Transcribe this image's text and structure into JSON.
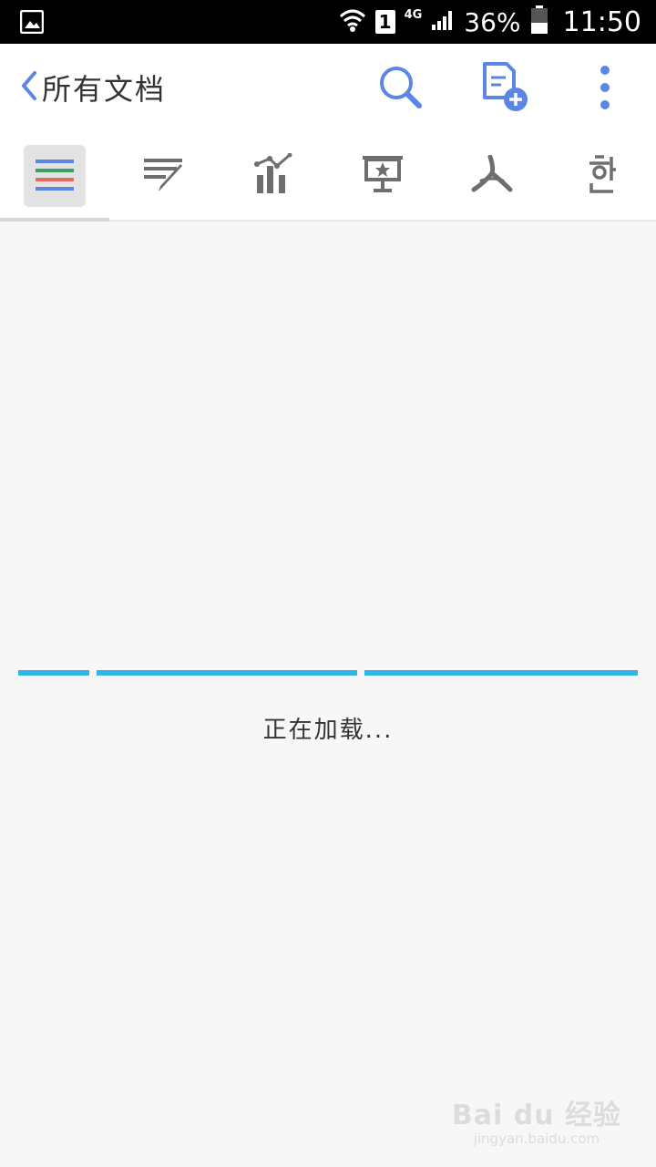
{
  "status_bar": {
    "sim_slot": "1",
    "network": "4G",
    "battery": "36%",
    "time": "11:50",
    "icons": [
      "image-icon",
      "wifi-icon",
      "signal-icon",
      "battery-icon"
    ]
  },
  "app_bar": {
    "title": "所有文档",
    "icons": [
      "back-chevron-icon",
      "search-icon",
      "new-document-icon",
      "more-vert-icon"
    ],
    "accent": "#5b86e5"
  },
  "tabs": [
    {
      "name": "all",
      "icon": "list-lines-icon",
      "selected": true
    },
    {
      "name": "document",
      "icon": "text-pen-icon",
      "selected": false
    },
    {
      "name": "spreadsheet",
      "icon": "chart-bars-icon",
      "selected": false
    },
    {
      "name": "presentation",
      "icon": "presentation-star-icon",
      "selected": false
    },
    {
      "name": "pdf",
      "icon": "pdf-icon",
      "selected": false
    },
    {
      "name": "hwp",
      "icon": "hangul-icon",
      "selected": false
    }
  ],
  "loading": {
    "text": "正在加载...",
    "progress_color": "#33b5e5"
  },
  "watermark": {
    "main": "Bai du 经验",
    "sub": "jingyan.baidu.com"
  }
}
